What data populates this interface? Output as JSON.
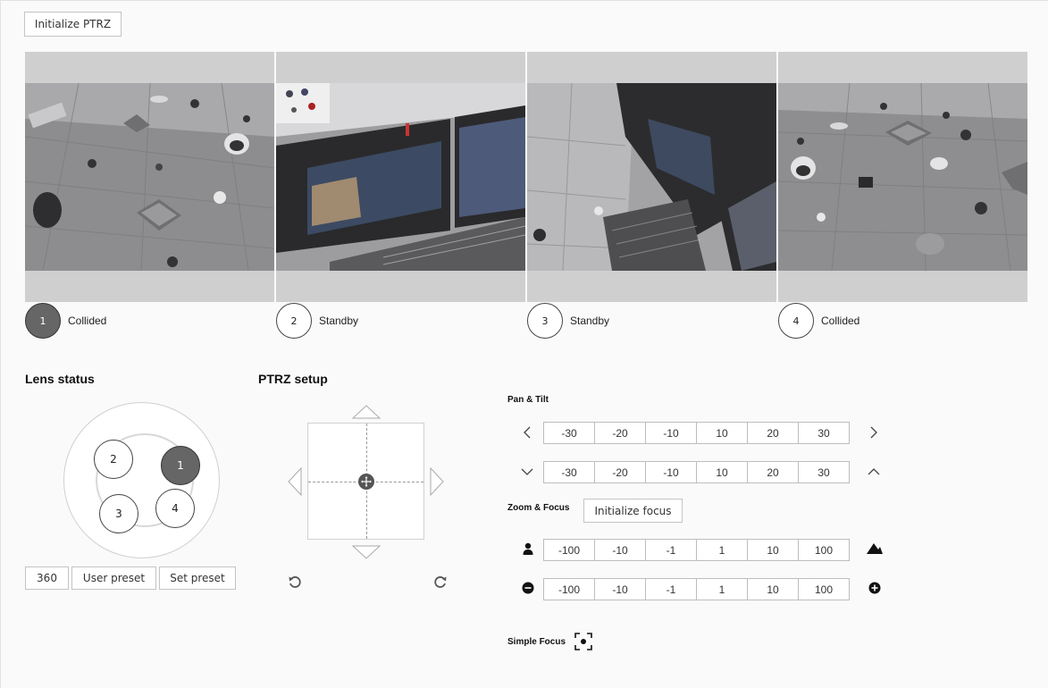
{
  "header": {
    "init_ptrz_label": "Initialize PTRZ"
  },
  "cameras": [
    {
      "number": "1",
      "status": "Collided",
      "active": true
    },
    {
      "number": "2",
      "status": "Standby",
      "active": false
    },
    {
      "number": "3",
      "status": "Standby",
      "active": false
    },
    {
      "number": "4",
      "status": "Collided",
      "active": false
    }
  ],
  "lens_status": {
    "title": "Lens status",
    "lenses": [
      "2",
      "1",
      "3",
      "4"
    ],
    "active_lens": "1",
    "buttons": {
      "b360": "360",
      "user_preset": "User preset",
      "set_preset": "Set preset"
    }
  },
  "ptrz_setup": {
    "title": "PTRZ setup"
  },
  "pan_tilt": {
    "title": "Pan & Tilt",
    "pan_values": [
      "-30",
      "-20",
      "-10",
      "10",
      "20",
      "30"
    ],
    "tilt_values": [
      "-30",
      "-20",
      "-10",
      "10",
      "20",
      "30"
    ]
  },
  "zoom_focus": {
    "title": "Zoom & Focus",
    "init_focus_label": "Initialize focus",
    "zoom_values": [
      "-100",
      "-10",
      "-1",
      "1",
      "10",
      "100"
    ],
    "focus_values": [
      "-100",
      "-10",
      "-1",
      "1",
      "10",
      "100"
    ]
  },
  "simple_focus": {
    "title": "Simple Focus"
  },
  "colors": {
    "active_badge": "#666666",
    "accent_dark": "#333333"
  }
}
